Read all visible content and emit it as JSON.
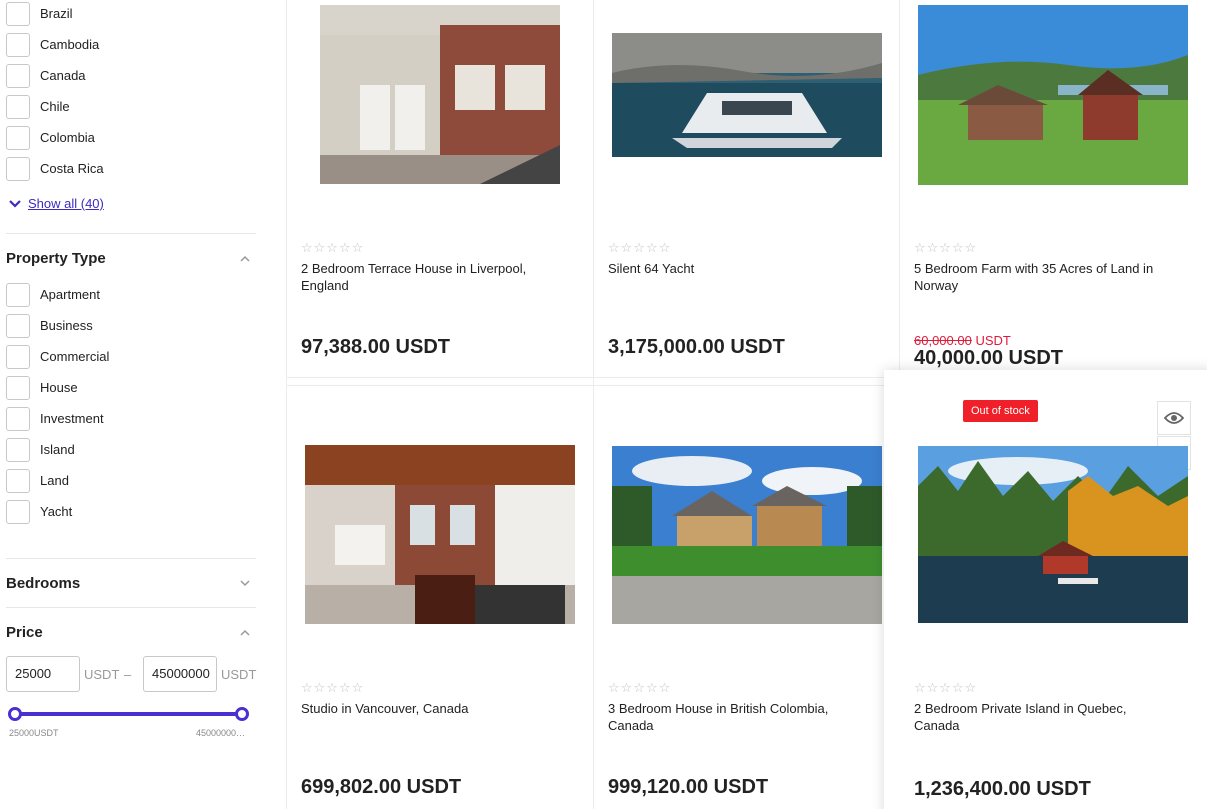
{
  "filters": {
    "countries": [
      "Brazil",
      "Cambodia",
      "Canada",
      "Chile",
      "Colombia",
      "Costa Rica"
    ],
    "show_all_label": "Show all (40)",
    "property_type": {
      "title": "Property Type",
      "options": [
        "Apartment",
        "Business",
        "Commercial",
        "House",
        "Investment",
        "Island",
        "Land",
        "Yacht"
      ]
    },
    "bedrooms": {
      "title": "Bedrooms"
    },
    "price": {
      "title": "Price",
      "min_value": "25000",
      "max_value": "45000000",
      "unit": "USDT",
      "separator": "–",
      "min_caption": "25000",
      "min_caption_unit": "USDT",
      "max_caption": "45000000…"
    }
  },
  "products": [
    {
      "title": "2 Bedroom Terrace House in Liverpool, England",
      "price": "97,388.00",
      "currency": "USDT",
      "stars": "☆☆☆☆☆"
    },
    {
      "title": "Silent 64 Yacht",
      "price": "3,175,000.00",
      "currency": "USDT",
      "stars": "☆☆☆☆☆"
    },
    {
      "title": "5 Bedroom Farm with 35 Acres of Land in Norway",
      "old_price": "60,000.00",
      "price": "40,000.00",
      "currency": "USDT",
      "stars": "☆☆☆☆☆"
    },
    {
      "title": "Studio in Vancouver, Canada",
      "price": "699,802.00",
      "currency": "USDT",
      "stars": "☆☆☆☆☆"
    },
    {
      "title": "3 Bedroom House in British Colombia, Canada",
      "price": "999,120.00",
      "currency": "USDT",
      "stars": "☆☆☆☆☆"
    },
    {
      "title": "2 Bedroom Private Island in Quebec, Canada",
      "price": "1,236,400.00",
      "currency": "USDT",
      "stars": "☆☆☆☆☆",
      "badge": "Out of stock"
    }
  ],
  "icons": {
    "show_all": "chevron-down-icon",
    "collapse": "chevron-up-icon",
    "expand": "chevron-down-icon",
    "quick_view": "eye-icon",
    "wishlist": "heart-icon"
  },
  "colors": {
    "accent": "#4a2fd1",
    "sale": "#e01b3a",
    "badge": "#f0202a",
    "link": "#3b2bbf"
  }
}
